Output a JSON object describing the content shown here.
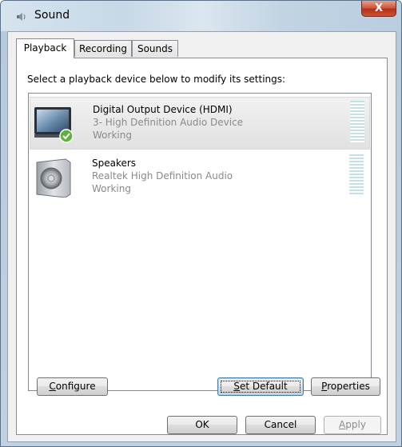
{
  "window": {
    "title": "Sound",
    "close_label": "X"
  },
  "tabs": [
    {
      "label": "Playback",
      "active": true
    },
    {
      "label": "Recording",
      "active": false
    },
    {
      "label": "Sounds",
      "active": false
    }
  ],
  "instruction": "Select a playback device below to modify its settings:",
  "devices": [
    {
      "name": "Digital Output Device (HDMI)",
      "description": "3- High Definition Audio Device",
      "status": "Working",
      "icon": "monitor-icon",
      "is_default": true,
      "selected": true
    },
    {
      "name": "Speakers",
      "description": "Realtek High Definition Audio",
      "status": "Working",
      "icon": "speaker-icon",
      "is_default": false,
      "selected": false
    }
  ],
  "buttons": {
    "configure": {
      "mnemonic": "C",
      "rest": "onfigure"
    },
    "set_default": {
      "mnemonic": "S",
      "rest": "et Default"
    },
    "properties": {
      "mnemonic": "P",
      "rest": "roperties"
    },
    "ok": "OK",
    "cancel": "Cancel",
    "apply": {
      "mnemonic": "A",
      "rest": "pply"
    }
  },
  "colors": {
    "title_bar": "#c7d8e6",
    "close_button": "#c9532f",
    "selection": "#e1e1e1",
    "level_meter": "#c4e0ea",
    "default_check": "#5cb23d"
  }
}
